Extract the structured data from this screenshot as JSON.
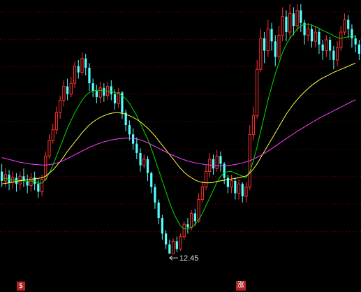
{
  "chart_data": {
    "type": "candlestick",
    "title": "",
    "xlabel": "",
    "ylabel": "",
    "ylim": [
      11.8,
      20.5
    ],
    "grid": true,
    "colors": {
      "up": "#ff3232",
      "down": "#54ffff",
      "ma_short": "#00e000",
      "ma_mid": "#ffff44",
      "ma_long": "#ff40ff",
      "grid": "#8b0000",
      "label": "#e0e0e0",
      "badge": "#b22222"
    },
    "candles": [
      [
        15.1,
        14.8,
        15.35,
        14.6
      ],
      [
        14.8,
        15.0,
        15.2,
        14.6
      ],
      [
        15.0,
        14.75,
        15.15,
        14.5
      ],
      [
        14.75,
        14.9,
        15.1,
        14.55
      ],
      [
        14.9,
        14.7,
        15.05,
        14.45
      ],
      [
        14.7,
        14.95,
        15.1,
        14.5
      ],
      [
        14.95,
        14.8,
        15.2,
        14.6
      ],
      [
        14.8,
        14.65,
        15.0,
        14.4
      ],
      [
        14.65,
        14.9,
        15.05,
        14.45
      ],
      [
        14.9,
        14.7,
        15.1,
        14.5
      ],
      [
        14.7,
        14.45,
        14.85,
        14.25
      ],
      [
        14.45,
        14.85,
        15.0,
        14.3
      ],
      [
        14.85,
        15.6,
        15.75,
        14.8
      ],
      [
        15.6,
        16.1,
        16.3,
        15.5
      ],
      [
        16.1,
        16.45,
        16.65,
        16.0
      ],
      [
        16.45,
        17.0,
        17.2,
        16.3
      ],
      [
        17.0,
        17.4,
        17.55,
        16.8
      ],
      [
        17.4,
        17.85,
        18.05,
        17.2
      ],
      [
        17.85,
        17.6,
        18.1,
        17.4
      ],
      [
        17.6,
        17.95,
        18.15,
        17.5
      ],
      [
        17.95,
        18.5,
        18.65,
        17.8
      ],
      [
        18.5,
        18.3,
        18.7,
        18.1
      ],
      [
        18.3,
        18.75,
        18.95,
        18.2
      ],
      [
        18.75,
        18.45,
        18.9,
        18.2
      ],
      [
        18.45,
        17.95,
        18.6,
        17.7
      ],
      [
        17.95,
        17.7,
        18.1,
        17.5
      ],
      [
        17.7,
        17.5,
        17.9,
        17.3
      ],
      [
        17.5,
        17.8,
        18.0,
        17.3
      ],
      [
        17.8,
        17.55,
        17.95,
        17.35
      ],
      [
        17.55,
        17.85,
        18.0,
        17.4
      ],
      [
        17.85,
        17.6,
        18.05,
        17.4
      ],
      [
        17.6,
        17.3,
        17.75,
        17.1
      ],
      [
        17.3,
        17.65,
        17.8,
        17.15
      ],
      [
        17.65,
        17.0,
        17.7,
        16.8
      ],
      [
        17.0,
        16.6,
        17.1,
        16.4
      ],
      [
        16.6,
        16.3,
        16.75,
        16.1
      ],
      [
        16.3,
        16.0,
        16.5,
        15.8
      ],
      [
        16.0,
        15.7,
        16.2,
        15.5
      ],
      [
        15.7,
        15.3,
        15.85,
        15.1
      ],
      [
        15.3,
        15.5,
        15.65,
        15.2
      ],
      [
        15.5,
        15.05,
        15.6,
        14.8
      ],
      [
        15.05,
        14.6,
        15.1,
        14.4
      ],
      [
        14.6,
        14.1,
        14.7,
        13.9
      ],
      [
        14.1,
        13.6,
        14.2,
        13.4
      ],
      [
        13.6,
        13.1,
        13.7,
        12.9
      ],
      [
        13.1,
        12.75,
        13.2,
        12.6
      ],
      [
        12.75,
        12.45,
        12.9,
        12.45
      ],
      [
        12.45,
        12.85,
        12.95,
        12.5
      ],
      [
        12.85,
        12.6,
        13.0,
        12.5
      ],
      [
        12.6,
        13.0,
        13.1,
        12.55
      ],
      [
        13.0,
        13.4,
        13.5,
        12.9
      ],
      [
        13.4,
        13.3,
        13.6,
        13.1
      ],
      [
        13.3,
        13.75,
        13.85,
        13.2
      ],
      [
        13.75,
        13.5,
        13.9,
        13.35
      ],
      [
        13.5,
        14.2,
        14.4,
        13.45
      ],
      [
        14.2,
        14.6,
        14.8,
        14.1
      ],
      [
        14.6,
        15.1,
        15.3,
        14.5
      ],
      [
        15.1,
        15.5,
        15.7,
        14.9
      ],
      [
        15.5,
        15.2,
        15.65,
        15.0
      ],
      [
        15.2,
        15.6,
        15.8,
        15.1
      ],
      [
        15.6,
        15.35,
        15.75,
        15.1
      ],
      [
        15.35,
        14.9,
        15.4,
        14.7
      ],
      [
        14.9,
        14.6,
        15.0,
        14.4
      ],
      [
        14.6,
        14.8,
        15.0,
        14.4
      ],
      [
        14.8,
        14.4,
        14.9,
        14.2
      ],
      [
        14.4,
        14.7,
        14.85,
        14.2
      ],
      [
        14.7,
        14.3,
        14.75,
        14.1
      ],
      [
        14.3,
        14.6,
        14.75,
        14.1
      ],
      [
        14.6,
        16.3,
        16.6,
        14.5
      ],
      [
        16.3,
        16.9,
        17.2,
        16.1
      ],
      [
        16.9,
        18.4,
        18.7,
        16.8
      ],
      [
        18.4,
        19.4,
        19.7,
        18.3
      ],
      [
        19.4,
        19.0,
        19.6,
        18.6
      ],
      [
        19.0,
        19.7,
        20.0,
        18.8
      ],
      [
        19.7,
        19.3,
        19.9,
        19.0
      ],
      [
        19.3,
        18.8,
        19.5,
        18.5
      ],
      [
        18.8,
        19.5,
        19.8,
        18.7
      ],
      [
        19.5,
        20.1,
        20.4,
        19.3
      ],
      [
        20.1,
        19.6,
        20.3,
        19.3
      ],
      [
        19.6,
        20.2,
        20.5,
        19.4
      ],
      [
        20.2,
        19.8,
        20.4,
        19.5
      ],
      [
        19.8,
        20.3,
        20.5,
        19.6
      ],
      [
        20.3,
        19.9,
        20.5,
        19.6
      ],
      [
        19.9,
        19.5,
        20.0,
        19.2
      ],
      [
        19.5,
        19.7,
        19.9,
        19.3
      ],
      [
        19.7,
        19.3,
        19.85,
        19.1
      ],
      [
        19.3,
        19.6,
        19.8,
        19.1
      ],
      [
        19.6,
        19.2,
        19.7,
        18.9
      ],
      [
        19.2,
        19.0,
        19.35,
        18.7
      ],
      [
        19.0,
        19.35,
        19.5,
        18.8
      ],
      [
        19.35,
        19.0,
        19.45,
        18.7
      ],
      [
        19.0,
        18.7,
        19.15,
        18.4
      ],
      [
        18.7,
        19.1,
        19.3,
        18.5
      ],
      [
        19.1,
        19.6,
        19.8,
        19.0
      ],
      [
        19.6,
        20.0,
        20.2,
        19.5
      ],
      [
        20.0,
        19.7,
        20.15,
        19.4
      ],
      [
        19.7,
        19.4,
        19.85,
        19.1
      ],
      [
        19.4,
        19.2,
        19.5,
        18.95
      ],
      [
        19.2,
        18.9,
        19.35,
        18.7
      ]
    ],
    "ma_short": [
      14.9,
      14.88,
      14.85,
      14.83,
      14.8,
      14.82,
      14.81,
      14.78,
      14.8,
      14.78,
      14.72,
      14.73,
      14.85,
      15.05,
      15.3,
      15.6,
      15.9,
      16.2,
      16.5,
      16.75,
      17.0,
      17.2,
      17.4,
      17.55,
      17.65,
      17.7,
      17.72,
      17.72,
      17.7,
      17.7,
      17.68,
      17.65,
      17.62,
      17.55,
      17.45,
      17.3,
      17.1,
      16.9,
      16.65,
      16.4,
      16.15,
      15.85,
      15.5,
      15.15,
      14.8,
      14.45,
      14.1,
      13.8,
      13.55,
      13.35,
      13.25,
      13.25,
      13.3,
      13.4,
      13.55,
      13.75,
      14.0,
      14.25,
      14.5,
      14.75,
      14.95,
      15.05,
      15.1,
      15.1,
      15.05,
      15.0,
      14.95,
      14.9,
      15.1,
      15.45,
      15.9,
      16.4,
      16.9,
      17.4,
      17.85,
      18.25,
      18.6,
      18.95,
      19.2,
      19.4,
      19.55,
      19.7,
      19.8,
      19.85,
      19.85,
      19.82,
      19.78,
      19.72,
      19.65,
      19.6,
      19.55,
      19.48,
      19.42,
      19.4,
      19.42,
      19.45,
      19.48,
      19.45
    ],
    "ma_mid": [
      14.7,
      14.72,
      14.74,
      14.76,
      14.78,
      14.8,
      14.82,
      14.84,
      14.85,
      14.87,
      14.88,
      14.9,
      14.95,
      15.05,
      15.15,
      15.28,
      15.42,
      15.58,
      15.75,
      15.9,
      16.05,
      16.2,
      16.35,
      16.48,
      16.6,
      16.7,
      16.78,
      16.85,
      16.9,
      16.95,
      16.98,
      17.0,
      17.0,
      16.98,
      16.95,
      16.9,
      16.85,
      16.78,
      16.7,
      16.6,
      16.5,
      16.38,
      16.25,
      16.1,
      15.95,
      15.8,
      15.65,
      15.5,
      15.35,
      15.2,
      15.08,
      14.98,
      14.9,
      14.83,
      14.78,
      14.75,
      14.74,
      14.74,
      14.75,
      14.78,
      14.8,
      14.82,
      14.84,
      14.86,
      14.88,
      14.9,
      14.93,
      14.96,
      15.05,
      15.18,
      15.35,
      15.55,
      15.75,
      15.95,
      16.15,
      16.35,
      16.55,
      16.75,
      16.95,
      17.12,
      17.28,
      17.42,
      17.55,
      17.67,
      17.78,
      17.88,
      17.97,
      18.05,
      18.12,
      18.18,
      18.24,
      18.3,
      18.35,
      18.4,
      18.45,
      18.5,
      18.55,
      18.6
    ],
    "ma_long": [
      15.55,
      15.52,
      15.49,
      15.46,
      15.43,
      15.4,
      15.38,
      15.36,
      15.34,
      15.33,
      15.32,
      15.31,
      15.31,
      15.32,
      15.34,
      15.37,
      15.41,
      15.46,
      15.52,
      15.58,
      15.64,
      15.7,
      15.76,
      15.82,
      15.88,
      15.93,
      15.98,
      16.02,
      16.06,
      16.09,
      16.12,
      16.14,
      16.16,
      16.17,
      16.18,
      16.18,
      16.17,
      16.15,
      16.12,
      16.08,
      16.03,
      15.97,
      15.91,
      15.85,
      15.79,
      15.73,
      15.67,
      15.62,
      15.57,
      15.52,
      15.48,
      15.44,
      15.41,
      15.38,
      15.36,
      15.34,
      15.32,
      15.31,
      15.3,
      15.29,
      15.29,
      15.29,
      15.3,
      15.31,
      15.33,
      15.35,
      15.38,
      15.41,
      15.45,
      15.5,
      15.56,
      15.62,
      15.69,
      15.76,
      15.84,
      15.92,
      16.0,
      16.08,
      16.16,
      16.24,
      16.32,
      16.4,
      16.47,
      16.54,
      16.61,
      16.68,
      16.75,
      16.82,
      16.88,
      16.94,
      17.0,
      17.06,
      17.12,
      17.18,
      17.24,
      17.3,
      17.36,
      17.42
    ],
    "min_marker": {
      "label": "12.45",
      "index": 46
    }
  },
  "badges": {
    "left": "$",
    "right": "涨"
  }
}
